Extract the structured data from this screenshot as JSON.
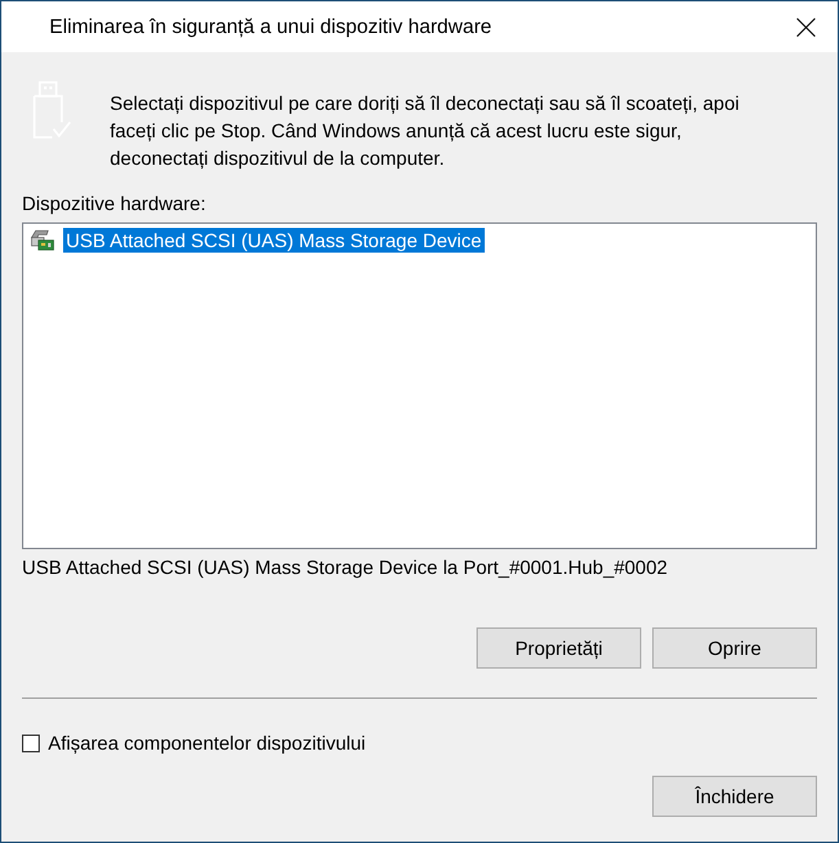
{
  "window": {
    "title": "Eliminarea în siguranță a unui dispozitiv hardware"
  },
  "instructions": "Selectați dispozitivul pe care doriți să îl deconectați sau să îl scoateți, apoi faceți clic pe Stop. Când Windows anunță că acest lucru este sigur, deconectați dispozitivul de la computer.",
  "devices_label": "Dispozitive hardware:",
  "devices": [
    {
      "name": "USB Attached SCSI (UAS) Mass Storage Device",
      "selected": true
    }
  ],
  "device_location": "USB Attached SCSI (UAS) Mass Storage Device la Port_#0001.Hub_#0002",
  "buttons": [
    {
      "label": "Proprietăți"
    },
    {
      "label": "Oprire"
    }
  ],
  "show_components": {
    "label": "Afișarea componentelor dispozitivului",
    "checked": false
  },
  "close_button": {
    "label": "Închidere"
  }
}
